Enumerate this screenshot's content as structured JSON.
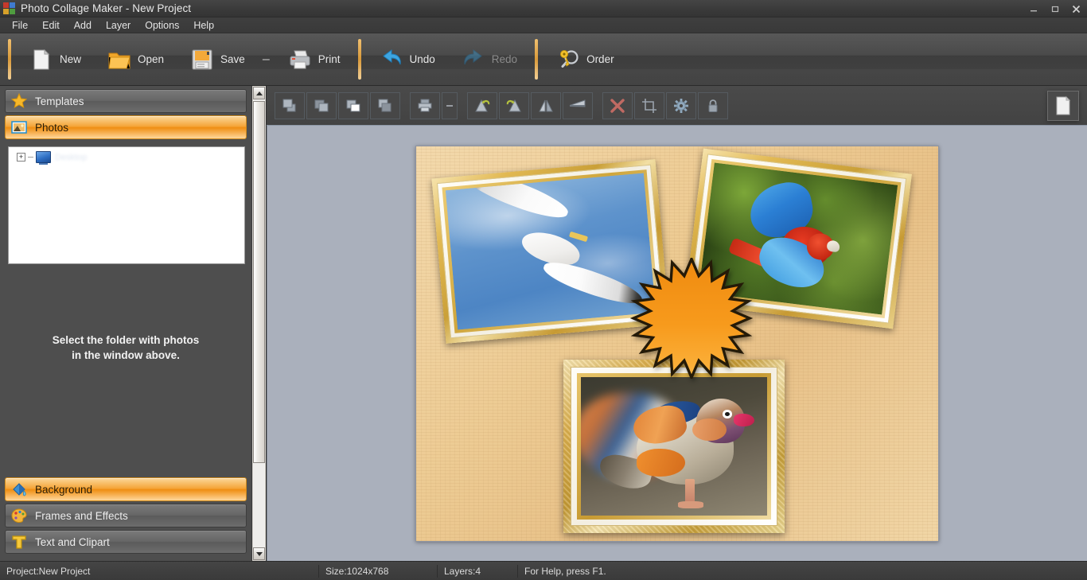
{
  "window": {
    "title": "Photo Collage Maker - New Project",
    "app_icon": "app-logo-icon",
    "controls": {
      "minimize": "—",
      "restore": "❐",
      "close": "✕"
    }
  },
  "menubar": {
    "items": [
      "File",
      "Edit",
      "Add",
      "Layer",
      "Options",
      "Help"
    ]
  },
  "toolbar": {
    "buttons": [
      {
        "label": "New",
        "icon": "new-document-icon",
        "enabled": true
      },
      {
        "label": "Open",
        "icon": "open-folder-icon",
        "enabled": true
      },
      {
        "label": "Save",
        "icon": "floppy-disk-icon",
        "enabled": true
      },
      {
        "label": "Print",
        "icon": "printer-icon",
        "enabled": true
      },
      {
        "label": "Undo",
        "icon": "undo-arrow-icon",
        "enabled": true
      },
      {
        "label": "Redo",
        "icon": "redo-arrow-icon",
        "enabled": false
      },
      {
        "label": "Order",
        "icon": "key-magnifier-icon",
        "enabled": true
      }
    ],
    "dash_separator": "–"
  },
  "sidebar": {
    "top_items": [
      {
        "label": "Templates",
        "icon": "star-icon",
        "active": false
      },
      {
        "label": "Photos",
        "icon": "photos-icon",
        "active": true
      }
    ],
    "tree": {
      "expander": "+",
      "node_icon": "desktop-monitor-icon",
      "node_label": "Desktop"
    },
    "hint_line1": "Select the folder with photos",
    "hint_line2": "in the window above.",
    "bottom_items": [
      {
        "label": "Background",
        "icon": "paint-bucket-icon",
        "active": true
      },
      {
        "label": "Frames and Effects",
        "icon": "palette-icon",
        "active": false
      },
      {
        "label": "Text and Clipart",
        "icon": "text-t-icon",
        "active": false
      }
    ],
    "scrollbar": {
      "up": "▲",
      "down": "▼"
    }
  },
  "canvas_toolbar": {
    "buttons": [
      {
        "name": "bring-to-front",
        "icon": "layer-front-icon"
      },
      {
        "name": "bring-forward",
        "icon": "layer-forward-icon"
      },
      {
        "name": "send-backward",
        "icon": "layer-backward-icon"
      },
      {
        "name": "send-to-back",
        "icon": "layer-back-icon"
      },
      {
        "name": "print-object",
        "icon": "printer-small-icon"
      },
      {
        "name": "separator-button",
        "icon": "dash-icon"
      },
      {
        "name": "rotate-left",
        "icon": "rotate-left-icon"
      },
      {
        "name": "rotate-right",
        "icon": "rotate-right-icon"
      },
      {
        "name": "flip-horizontal",
        "icon": "flip-horizontal-icon"
      },
      {
        "name": "flip-vertical",
        "icon": "flip-vertical-icon"
      },
      {
        "name": "delete-object",
        "icon": "red-x-icon"
      },
      {
        "name": "crop-object",
        "icon": "crop-icon"
      },
      {
        "name": "object-properties",
        "icon": "gear-icon"
      },
      {
        "name": "lock-object",
        "icon": "lock-icon"
      }
    ],
    "page_button": {
      "name": "page-setup",
      "icon": "page-icon"
    }
  },
  "collage": {
    "background": "#eecb94",
    "items": [
      {
        "name": "seagull-photo",
        "subject": "Seagull in flight",
        "frame": "gold-frame",
        "rotation": -5
      },
      {
        "name": "parrot-photo",
        "subject": "Scarlet macaw in flight",
        "frame": "gold-frame",
        "rotation": 7
      },
      {
        "name": "duck-photo",
        "subject": "Mandarin duck",
        "frame": "ornate-gold-frame",
        "rotation": 0
      },
      {
        "name": "starburst-clipart",
        "subject": "Orange starburst",
        "frame": "none",
        "rotation": 0
      }
    ],
    "starburst_color_top": "#f08a12",
    "starburst_color_bottom": "#fbb03b"
  },
  "statusbar": {
    "project": "Project:New Project",
    "size": "Size:1024x768",
    "layers": "Layers:4",
    "help": "For Help, press F1."
  },
  "colors": {
    "accent_orange": "#f0a63a",
    "chrome_dark": "#3c3c3c",
    "workspace": "#aab0bc",
    "delete_red": "#c06a63"
  }
}
